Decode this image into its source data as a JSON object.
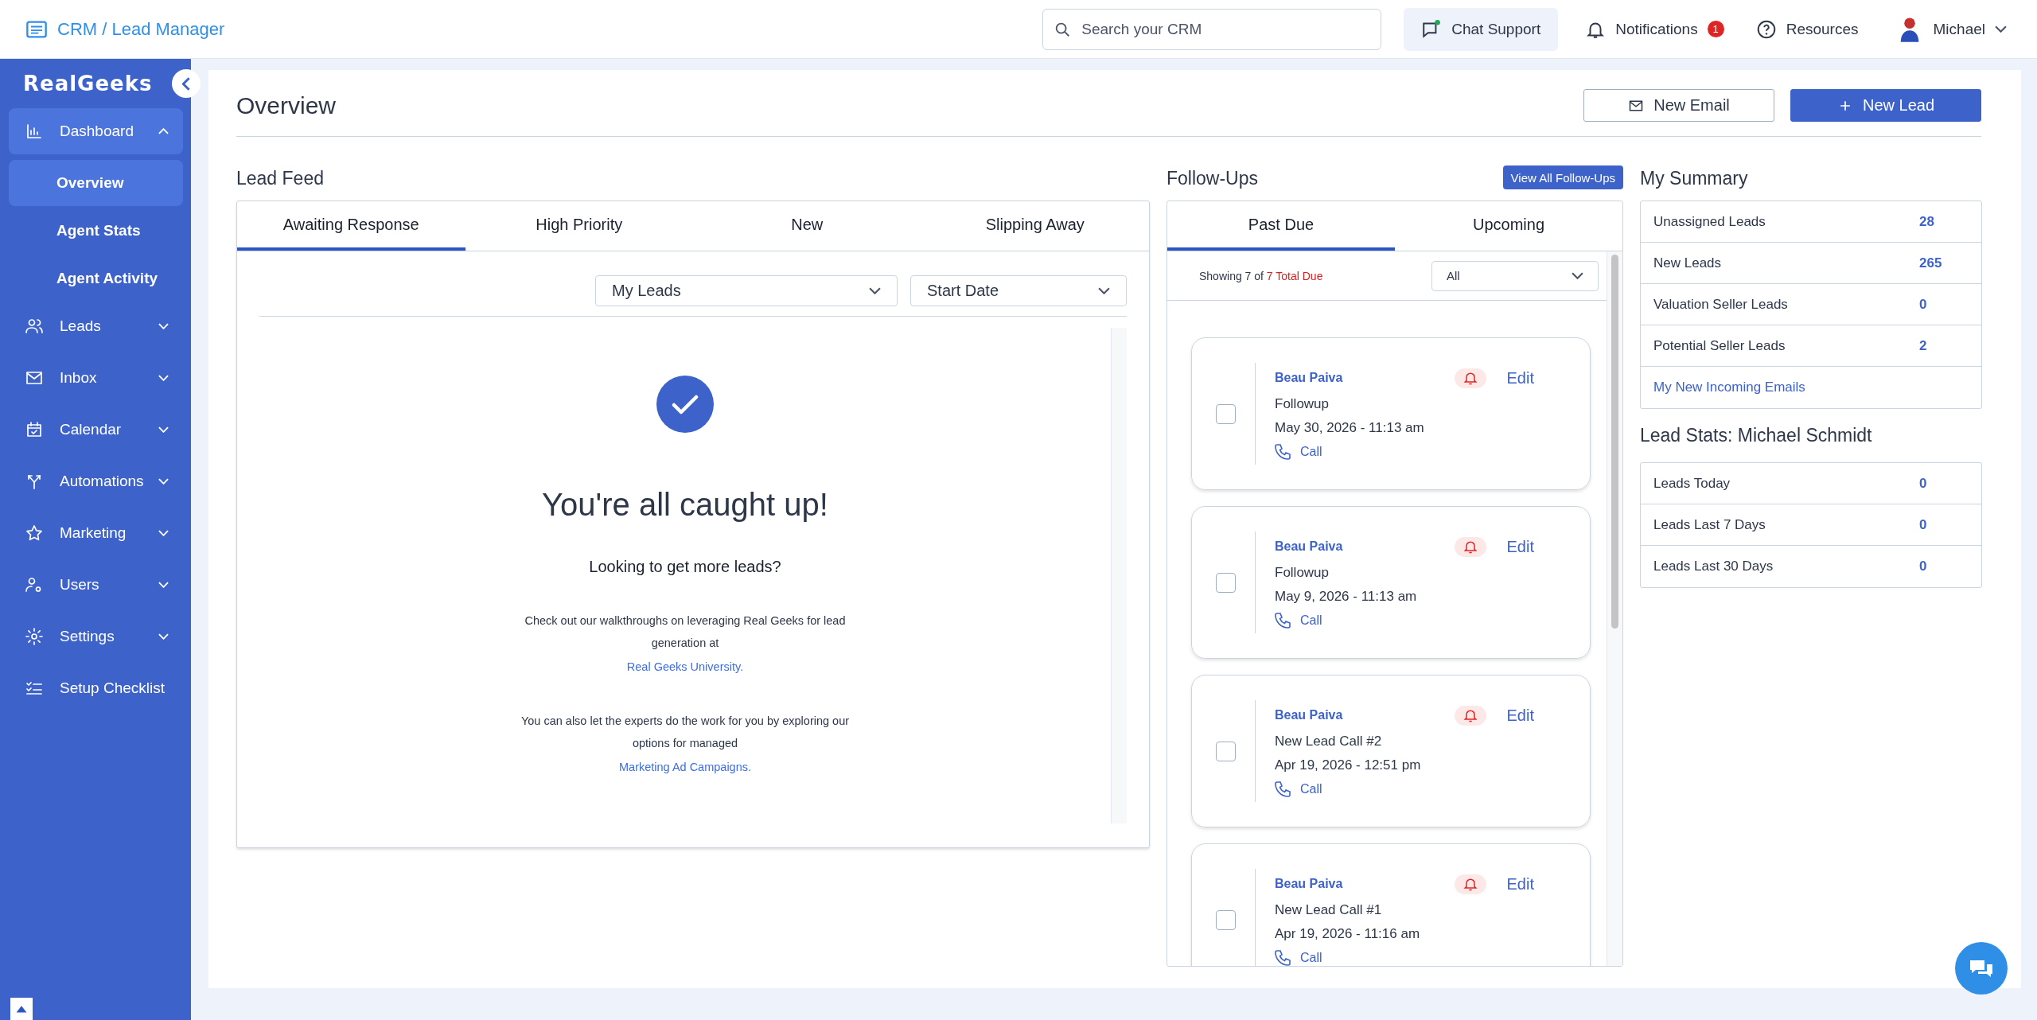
{
  "header": {
    "app_title": "CRM / Lead Manager",
    "search": {
      "placeholder": "Search your CRM"
    },
    "chat_support": "Chat Support",
    "notifications": {
      "label": "Notifications",
      "count": "1"
    },
    "resources": "Resources",
    "user": "Michael"
  },
  "sidebar": {
    "logo": "RealGeeks",
    "items": [
      {
        "label": "Dashboard",
        "kind": "group",
        "expanded": true,
        "children": [
          {
            "label": "Overview",
            "selected": true
          },
          {
            "label": "Agent Stats",
            "selected": false
          },
          {
            "label": "Agent Activity",
            "selected": false
          }
        ]
      },
      {
        "label": "Leads",
        "kind": "group",
        "expanded": false
      },
      {
        "label": "Inbox",
        "kind": "group",
        "expanded": false
      },
      {
        "label": "Calendar",
        "kind": "group",
        "expanded": false
      },
      {
        "label": "Automations",
        "kind": "group",
        "expanded": false
      },
      {
        "label": "Marketing",
        "kind": "group",
        "expanded": false
      },
      {
        "label": "Users",
        "kind": "group",
        "expanded": false
      },
      {
        "label": "Settings",
        "kind": "group",
        "expanded": false
      },
      {
        "label": "Setup Checklist",
        "kind": "link"
      }
    ]
  },
  "page": {
    "title": "Overview",
    "buttons": [
      {
        "label": "New Email",
        "kind": "secondary"
      },
      {
        "label": "New Lead",
        "kind": "primary"
      }
    ]
  },
  "lead_feed": {
    "title": "Lead Feed",
    "tabs": [
      {
        "label": "Awaiting Response",
        "selected": true
      },
      {
        "label": "High Priority",
        "selected": false
      },
      {
        "label": "New",
        "selected": false
      },
      {
        "label": "Slipping Away",
        "selected": false
      }
    ],
    "filters": [
      {
        "value": "My Leads"
      },
      {
        "value": "Start Date"
      }
    ],
    "empty_state": {
      "title": "You're all caught up!",
      "subtitle": "Looking to get more leads?",
      "paragraphs": [
        {
          "text": "Check out our walkthroughs on leveraging Real Geeks for lead generation at",
          "link": "Real Geeks University."
        },
        {
          "text": "You can also let the experts do the work for you by exploring our options for managed",
          "link": "Marketing Ad Campaigns."
        }
      ]
    }
  },
  "follow_ups": {
    "title": "Follow-Ups",
    "view_all": "View All Follow-Ups",
    "tabs": [
      {
        "label": "Past Due",
        "selected": true
      },
      {
        "label": "Upcoming",
        "selected": false
      }
    ],
    "showing": "Showing 7 of",
    "total_due": "7 Total Due",
    "filter": {
      "value": "All"
    },
    "items": [
      {
        "name": "Beau Paiva",
        "task": "Followup",
        "datetime": "May 30, 2026 - 11:13 am",
        "action": "Call",
        "edit": "Edit",
        "checked": false,
        "alert": true
      },
      {
        "name": "Beau Paiva",
        "task": "Followup",
        "datetime": "May 9, 2026 - 11:13 am",
        "action": "Call",
        "edit": "Edit",
        "checked": false,
        "alert": true
      },
      {
        "name": "Beau Paiva",
        "task": "New Lead Call #2",
        "datetime": "Apr 19, 2026 - 12:51 pm",
        "action": "Call",
        "edit": "Edit",
        "checked": false,
        "alert": true
      },
      {
        "name": "Beau Paiva",
        "task": "New Lead Call #1",
        "datetime": "Apr 19, 2026 - 11:16 am",
        "action": "Call",
        "edit": "Edit",
        "checked": false,
        "alert": true
      }
    ]
  },
  "summary": {
    "title": "My Summary",
    "rows": [
      {
        "kind": "stat",
        "label": "Unassigned Leads",
        "value": "28"
      },
      {
        "kind": "stat",
        "label": "New Leads",
        "value": "265"
      },
      {
        "kind": "stat",
        "label": "Valuation Seller Leads",
        "value": "0"
      },
      {
        "kind": "stat",
        "label": "Potential Seller Leads",
        "value": "2"
      },
      {
        "kind": "link",
        "label": "My New Incoming Emails"
      }
    ]
  },
  "lead_stats": {
    "title": "Lead Stats: Michael Schmidt",
    "rows": [
      {
        "label": "Leads Today",
        "value": "0"
      },
      {
        "label": "Leads Last 7 Days",
        "value": "0"
      },
      {
        "label": "Leads Last 30 Days",
        "value": "0"
      }
    ]
  }
}
